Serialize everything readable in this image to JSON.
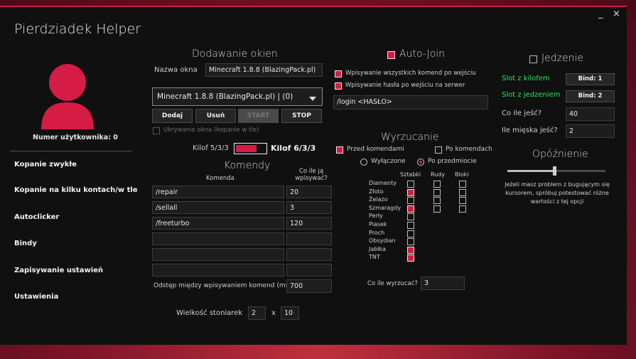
{
  "window": {
    "title": "Pierdziadek Helper",
    "minimize": "_",
    "close": "×"
  },
  "user": {
    "number_label": "Numer użytkownika: 0"
  },
  "sidebar": {
    "items": [
      {
        "label": "Kopanie zwykłe"
      },
      {
        "label": "Kopanie na kilku kontach/w tle"
      },
      {
        "label": "Autoclicker"
      },
      {
        "label": "Bindy"
      },
      {
        "label": "Zapisywanie ustawień"
      },
      {
        "label": "Ustawienia"
      }
    ]
  },
  "windows_section": {
    "title": "Dodawanie okien",
    "name_label": "Nazwa okna",
    "name_value": "Minecraft 1.8.8 (BlazingPack.pl)",
    "select_value": "Minecraft 1.8.8 (BlazingPack.pl) | (0)",
    "buttons": {
      "add": "Dodaj",
      "remove": "Usuń",
      "start": "START",
      "stop": "STOP"
    },
    "hide_label": "Ukrywanie okna (kopanie w tle)"
  },
  "pickaxe": {
    "left": "Kilof 5/3/3",
    "right": "Kilof 6/3/3"
  },
  "commands": {
    "title": "Komendy",
    "col_command": "Komenda",
    "col_interval": "Co ile ją wpisywać?",
    "rows": [
      {
        "command": "/repair",
        "interval": "20"
      },
      {
        "command": "/sellall",
        "interval": "3"
      },
      {
        "command": "/freeturbo",
        "interval": "120"
      },
      {
        "command": "",
        "interval": ""
      },
      {
        "command": "",
        "interval": ""
      },
      {
        "command": "",
        "interval": ""
      }
    ],
    "delay_label": "Odstęp między wpisywaniem komend (ms)",
    "delay_value": "700"
  },
  "stonecutter": {
    "label": "Wielkość stoniarek",
    "width": "2",
    "x": "x",
    "height": "10"
  },
  "autojoin": {
    "title": "Auto-Join",
    "opt_commands": "Wpisywanie wszystkich komend po wejściu",
    "opt_password": "Wpisywanie hasła po wejściu na serwer",
    "login_value": "/login <HASŁO>"
  },
  "throwing": {
    "title": "Wyrzucanie",
    "before_commands": "Przed komendami",
    "after_commands": "Po komendach",
    "off": "Wyłączone",
    "per_item": "Po przedmiocie",
    "col_ingots": "Sztabki",
    "col_ores": "Rudy",
    "col_blocks": "Bloki",
    "items": [
      {
        "name": "Diamenty",
        "ingot": false,
        "ore": false,
        "block": false
      },
      {
        "name": "Złoto",
        "ingot": true,
        "ore": false,
        "block": false
      },
      {
        "name": "Żelazo",
        "ingot": false,
        "ore": false,
        "block": false
      },
      {
        "name": "Szmaragdy",
        "ingot": true,
        "ore": false,
        "block": false
      },
      {
        "name": "Perły",
        "ingot": false
      },
      {
        "name": "Piasek",
        "ingot": false
      },
      {
        "name": "Proch",
        "ingot": false
      },
      {
        "name": "Obsydian",
        "ingot": false
      },
      {
        "name": "Jabłka",
        "ingot": true
      },
      {
        "name": "TNT",
        "ingot": true
      }
    ],
    "interval_label": "Co ile wyrzucać?",
    "interval_value": "3"
  },
  "food": {
    "title": "Jedzenie",
    "pickaxe_slot": "Slot z kilofem",
    "pickaxe_bind": "Bind: 1",
    "food_slot": "Slot z jedzeniem",
    "food_bind": "Bind: 2",
    "eat_every_label": "Co ile jeść?",
    "eat_every_value": "40",
    "meat_label": "Ile mięska jeść?",
    "meat_value": "2"
  },
  "delay": {
    "title": "Opóźnienie",
    "level": 0.48,
    "note": "Jeżeli masz problem z bugującym się kursorem, spróbuj potestować różne wartości z tej opcji"
  },
  "colors": {
    "accent": "#d61b45",
    "green": "#2fe35c"
  }
}
